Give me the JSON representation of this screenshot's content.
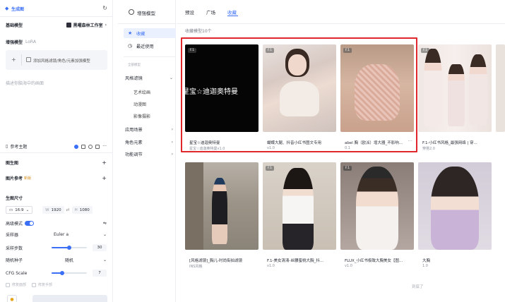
{
  "left_panel": {
    "title": "生成图",
    "base_model_label": "基础模型",
    "base_model_value": "黑曜森林工作室",
    "lora_label": "增强模型",
    "lora_hint": "LoRA",
    "lora_add_text": "添加风格滤镜/角色/元素加强模型",
    "prompt_placeholder": "描述你脑海中的画面",
    "reference_section_label": "参考主题",
    "image_ctrl_label": "图生图",
    "image_ref_label": "图片参考",
    "image_ref_tag": "新版",
    "size_label": "生图尺寸",
    "ratio_value": "16:9",
    "width_label": "W",
    "width_value": "1920",
    "height_label": "H",
    "height_value": "1080",
    "hd_label": "高级模式",
    "sampler_label": "采样器",
    "sampler_value": "Euler a",
    "steps_label": "采样步数",
    "steps_value": "30",
    "steps_fraction": 0.5,
    "seed_label": "随机种子",
    "seed_value": "随机",
    "cfg_label": "CFG Scale",
    "cfg_value": "7",
    "cfg_fraction": 0.3,
    "check1_label": "修复面部",
    "check2_label": "修复手部"
  },
  "nav": {
    "header": "增强模型",
    "items": {
      "favorites": "收藏",
      "recent": "最近使用",
      "section_all": "全部模型",
      "style_filter": "风格滤镜",
      "sub_art": "艺术绘画",
      "sub_anime": "动漫图",
      "sub_photo": "影像摄影",
      "app_scene": "应用场景",
      "characters": "角色元素",
      "func_adjust": "功能调节"
    }
  },
  "main": {
    "tabs": [
      "预设",
      "广场",
      "收藏"
    ],
    "active_tab": "收藏",
    "count_text": "收藏模型10个",
    "end_note": "到底了",
    "cards_row1": [
      {
        "badge": "F.1",
        "name": "星宝☆迪迦奥特曼",
        "sub": "星宝☆迪迦奥特曼v1.0",
        "overlay": "星宝☆迪迦奥特曼"
      },
      {
        "badge": "F.1",
        "name": "蝴蝶大腿、抖音小红书图文专用",
        "sub": "v1.0",
        "overlay": ""
      },
      {
        "badge": "F.1",
        "name": "abel 胸（欧派）增大器_不影响...",
        "sub": "0.1",
        "overlay": ""
      },
      {
        "badge": "F.1",
        "name": "F.1-小红书风格_最强网络 | 穿...",
        "sub": "穿搭2.0",
        "overlay": ""
      }
    ],
    "cards_row2": [
      {
        "badge": "F.1",
        "name": "[风格滤镜]_胸儿-时尚街拍滤镜",
        "sub": "INS风格"
      },
      {
        "badge": "F.1",
        "name": "F.1-美女清清-丝腰蜜桃大胸_抖...",
        "sub": "v1.0"
      },
      {
        "badge": "F.1",
        "name": "FLUX_小红书极致大胸美女【图...",
        "sub": "v1.0"
      },
      {
        "badge": "",
        "name": "大胸",
        "sub": "1.0"
      }
    ]
  },
  "colors": {
    "accent": "#3b6ff5",
    "highlight_frame": "#e0272b",
    "panel_bg": "#f4f5f8"
  }
}
